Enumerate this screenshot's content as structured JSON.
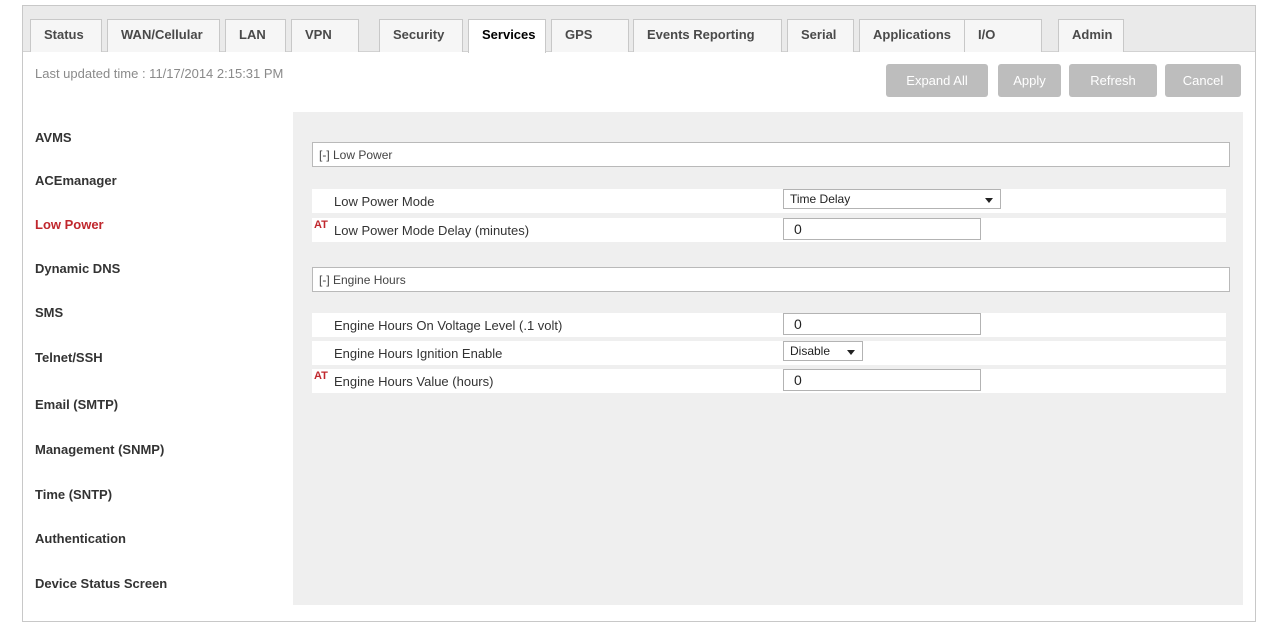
{
  "tabs": [
    {
      "label": "Status",
      "active": false
    },
    {
      "label": "WAN/Cellular",
      "active": false
    },
    {
      "label": "LAN",
      "active": false
    },
    {
      "label": "VPN",
      "active": false
    },
    {
      "label": "Security",
      "active": false
    },
    {
      "label": "Services",
      "active": true
    },
    {
      "label": "GPS",
      "active": false
    },
    {
      "label": "Events Reporting",
      "active": false
    },
    {
      "label": "Serial",
      "active": false
    },
    {
      "label": "Applications",
      "active": false
    },
    {
      "label": "I/O",
      "active": false
    },
    {
      "label": "Admin",
      "active": false
    }
  ],
  "header": {
    "last_updated": "Last updated time : 11/17/2014 2:15:31 PM",
    "buttons": {
      "expand_all": "Expand All",
      "apply": "Apply",
      "refresh": "Refresh",
      "cancel": "Cancel"
    }
  },
  "sidebar": {
    "items": [
      {
        "label": "AVMS"
      },
      {
        "label": "ACEmanager"
      },
      {
        "label": "Low Power",
        "active": true
      },
      {
        "label": "Dynamic DNS"
      },
      {
        "label": "SMS"
      },
      {
        "label": "Telnet/SSH"
      },
      {
        "label": "Email (SMTP)"
      },
      {
        "label": "Management (SNMP)"
      },
      {
        "label": "Time (SNTP)"
      },
      {
        "label": "Authentication"
      },
      {
        "label": "Device Status Screen"
      }
    ]
  },
  "sections": {
    "low_power": {
      "title": "[-] Low Power",
      "mode_label": "Low Power Mode",
      "mode_value": "Time Delay",
      "delay_tag": "AT",
      "delay_label": "Low Power Mode Delay (minutes)",
      "delay_value": "0"
    },
    "engine_hours": {
      "title": "[-] Engine Hours",
      "voltage_label": "Engine Hours On Voltage Level (.1 volt)",
      "voltage_value": "0",
      "ignition_label": "Engine Hours Ignition Enable",
      "ignition_value": "Disable",
      "value_tag": "AT",
      "value_label": "Engine Hours Value (hours)",
      "value_value": "0"
    }
  },
  "colors": {
    "active_sidebar": "#c0272d",
    "button_bg": "#bdbdbd",
    "panel_bg": "#efefef"
  }
}
